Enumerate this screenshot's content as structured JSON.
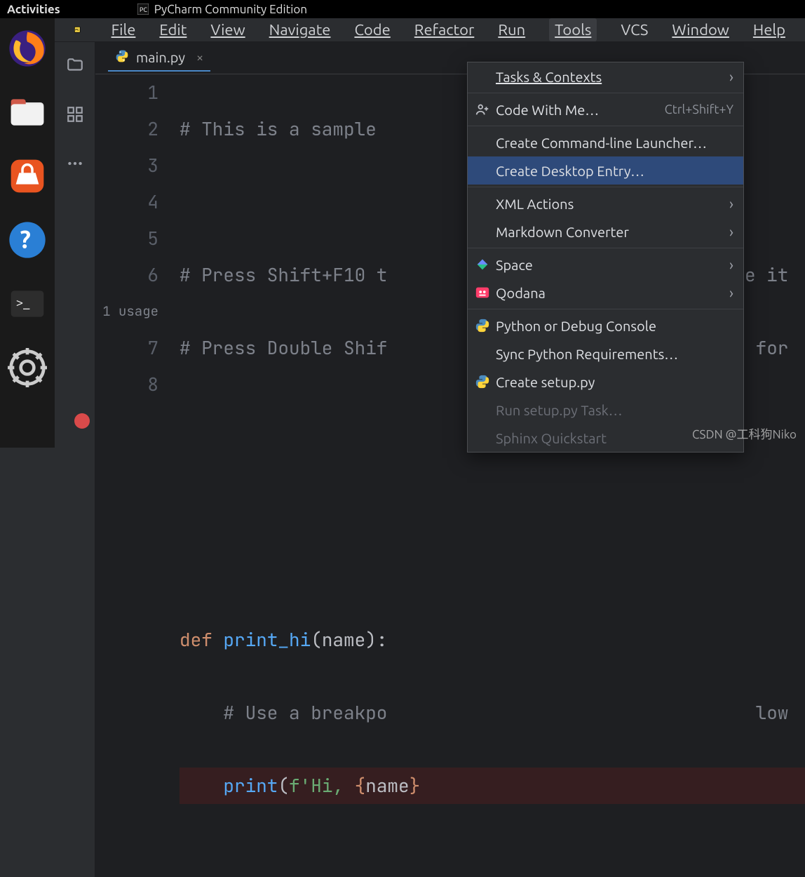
{
  "gnome": {
    "activities": "Activities",
    "app_title": "PyCharm Community Edition"
  },
  "menu": {
    "file": "File",
    "edit": "Edit",
    "view": "View",
    "navigate": "Navigate",
    "code": "Code",
    "refactor": "Refactor",
    "run": "Run",
    "tools": "Tools",
    "vcs": "VCS",
    "window": "Window",
    "help": "Help"
  },
  "tab": {
    "filename": "main.py"
  },
  "gutter": {
    "l1": "1",
    "l2": "2",
    "l3": "3",
    "l4": "4",
    "l5": "5",
    "l6": "6",
    "usage": "1 usage",
    "l7": "7",
    "l8": "8"
  },
  "code": {
    "l1": "# This is a sample ",
    "l3": "# Press Shift+F10 t",
    "l3_tail": "e it ",
    "l4": "# Press Double Shif",
    "l4_tail": "for ",
    "l7_def": "def",
    "l7_fn": " print_hi",
    "l7_rest": "(name):",
    "l8": "    # Use a breakpo",
    "l8_tail": "low ",
    "l9_fn": "    print",
    "l9_p1": "(",
    "l9_str1": "f'Hi, ",
    "l9_br1": "{",
    "l9_var": "name",
    "l9_br2": "}"
  },
  "dropdown": {
    "tasks": "Tasks & Contexts",
    "code_with_me": "Code With Me…",
    "code_with_me_short": "Ctrl+Shift+Y",
    "cmd_launcher": "Create Command-line Launcher…",
    "desktop_entry": "Create Desktop Entry…",
    "xml": "XML Actions",
    "markdown": "Markdown Converter",
    "space": "Space",
    "qodana": "Qodana",
    "python_console": "Python or Debug Console",
    "sync_req": "Sync Python Requirements…",
    "create_setup": "Create setup.py",
    "run_setup": "Run setup.py Task…",
    "sphinx": "Sphinx Quickstart"
  },
  "watermark": "CSDN @工科狗Niko"
}
